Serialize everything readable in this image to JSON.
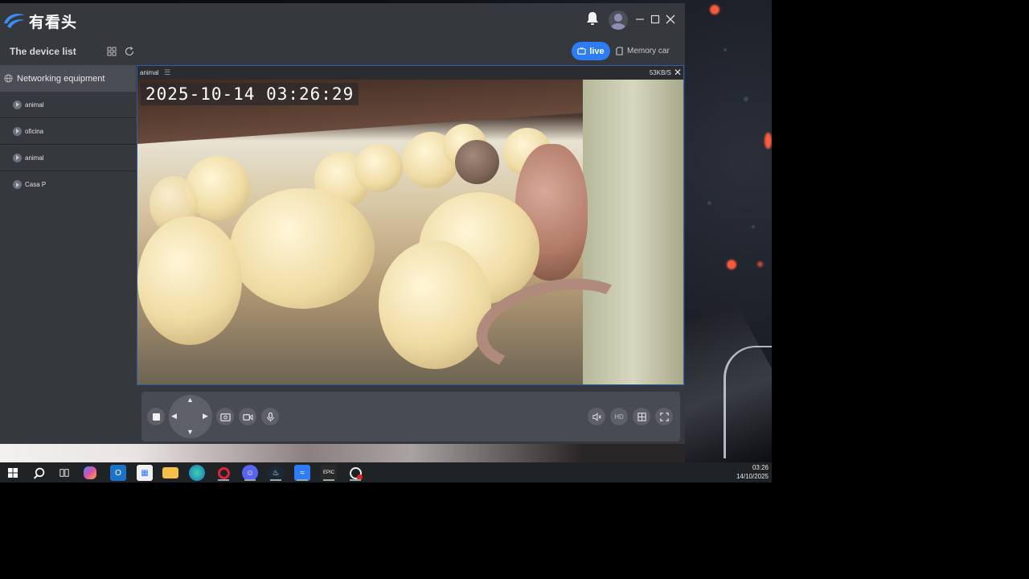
{
  "app": {
    "brand_name": "有看头",
    "window_controls": [
      "minimize",
      "maximize",
      "close"
    ]
  },
  "toolbar": {
    "device_list_title": "The device list",
    "live_label": "live",
    "memory_label": "Memory car"
  },
  "sidebar": {
    "group_label": "Networking equipment",
    "devices": [
      {
        "label": "animal"
      },
      {
        "label": "oficina"
      },
      {
        "label": "animal"
      },
      {
        "label": "Casa P"
      }
    ]
  },
  "video": {
    "channel_name": "animal",
    "bitrate": "53KB/S",
    "osd_timestamp": "2025-10-14  03:26:29"
  },
  "controls": {
    "quality_label": "HD"
  },
  "taskbar": {
    "time": "03:26",
    "date": "14/10/2025"
  },
  "colors": {
    "accent": "#2d7cf6",
    "window_bg": "#35383d",
    "sidebar_group_bg": "#4a4d53",
    "control_bar_bg": "#484b51"
  }
}
